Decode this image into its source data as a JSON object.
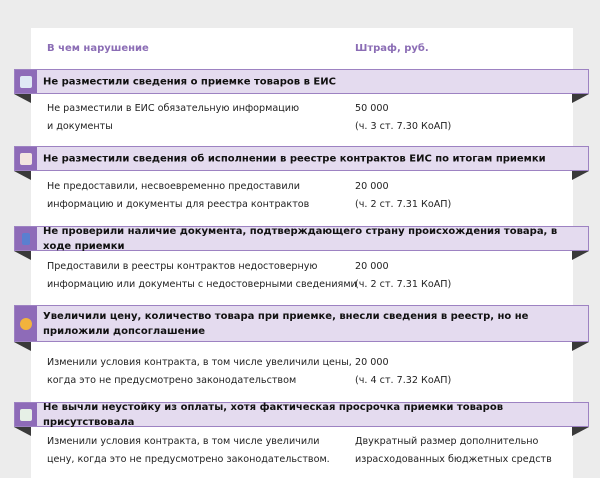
{
  "header": {
    "col_violation": "В чем нарушение",
    "col_fine": "Штраф, руб."
  },
  "sections": [
    {
      "icon": "document-chart-icon",
      "title": "Не разместили сведения о приемке товаров в ЕИС",
      "violation": "Не разместили в ЕИС обязательную информацию\nи документы",
      "fine": "50 000\n(ч. 3 ст. 7.30 КоАП)"
    },
    {
      "icon": "document-list-icon",
      "title": "Не разместили сведения об исполнении в реестре контрактов ЕИС по итогам приемки",
      "violation": "Не предоставили, несвоевременно предоставили\nинформацию и документы для реестра контрактов",
      "fine": "20 000\n(ч. 2 ст. 7.31 КоАП)"
    },
    {
      "icon": "phone-icon",
      "title": "Не проверили наличие документа, подтверждающего страну происхождения товара, в ходе приемки",
      "violation": "Предоставили в реестры контрактов недостоверную\nинформацию или документы с недостоверными сведениями",
      "fine": "20 000\n(ч. 2 ст. 7.31 КоАП)"
    },
    {
      "icon": "ruble-coin-icon",
      "title": "Увеличили цену, количество товара при приемке, внесли сведения в реестр, но не приложили допсоглашение",
      "violation": "Изменили условия контракта, в том числе увеличили цены,\nкогда это не предусмотрено законодательством",
      "fine": "20 000\n(ч. 4 ст. 7.32 КоАП)"
    },
    {
      "icon": "checklist-pen-icon",
      "title": "Не вычли неустойку из оплаты, хотя фактическая просрочка приемки товаров присутствовала",
      "violation": "Изменили условия контракта, в том числе увеличили\nцену, когда это не предусмотрено законодательством.",
      "fine": "Двукратный размер дополнительно\nизрасходованных бюджетных средств"
    }
  ],
  "colors": {
    "accent": "#8e6bb8",
    "banner_fill": "#e4dbef",
    "header_text": "#8b6db5"
  }
}
